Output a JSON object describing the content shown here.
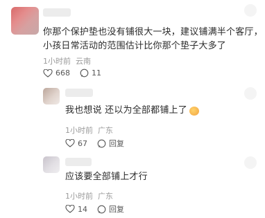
{
  "comments": [
    {
      "text_line1": "你那个保护垫也没有铺很大一块，建议铺满半个客厅，",
      "text_line2": "小孩日常活动的范围估计比你那个垫子大多了",
      "time": "1小时前",
      "location": "云南",
      "likes": "668",
      "replies": "11"
    },
    {
      "text": "我也想说 还以为全部都铺上了",
      "time": "1小时前",
      "location": "广东",
      "likes": "67",
      "reply_label": "回复"
    },
    {
      "text": "应该要全部铺上才行",
      "time": "1小时前",
      "location": "广东",
      "likes": "14",
      "reply_label": "回复"
    }
  ]
}
